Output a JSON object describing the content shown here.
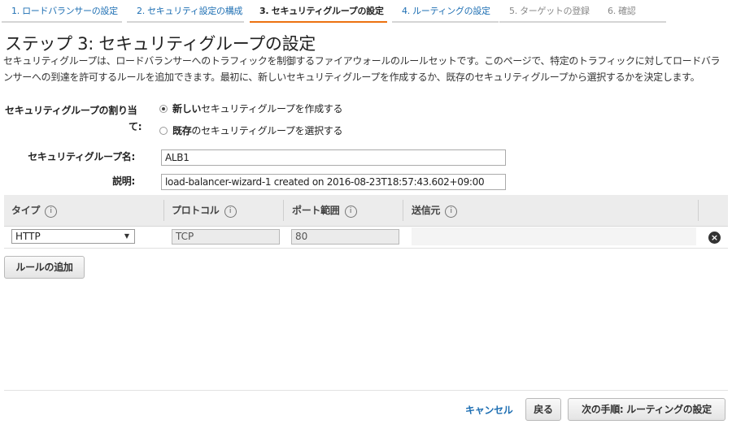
{
  "wizard": {
    "steps": [
      {
        "label": "1. ロードバランサーの設定"
      },
      {
        "label": "2. セキュリティ設定の構成"
      },
      {
        "label": "3. セキュリティグループの設定"
      },
      {
        "label": "4. ルーティングの設定"
      },
      {
        "label": "5. ターゲットの登録"
      },
      {
        "label": "6. 確認"
      }
    ],
    "active_step": 3
  },
  "page": {
    "title": "ステップ 3: セキュリティグループの設定",
    "description": "セキュリティグループは、ロードバランサーへのトラフィックを制御するファイアウォールのルールセットです。このページで、特定のトラフィックに対してロードバランサーへの到達を許可するルールを追加できます。最初に、新しいセキュリティグループを作成するか、既存のセキュリティグループから選択するかを決定します。"
  },
  "form": {
    "assign_label_line1": "セキュリティグループの割り当",
    "assign_label_line2": "て:",
    "option_new_bold": "新しい",
    "option_new_rest": "セキュリティグループを作成する",
    "option_existing_bold": "既存",
    "option_existing_rest": "のセキュリティグループを選択する",
    "selected_option": "new",
    "name_label": "セキュリティグループ名:",
    "name_value": "ALB1",
    "desc_label": "説明:",
    "desc_value": "load-balancer-wizard-1 created on 2016-08-23T18:57:43.602+09:00"
  },
  "rules_table": {
    "headers": {
      "type": "タイプ",
      "protocol": "プロトコル",
      "port_range": "ポート範囲",
      "source": "送信元"
    },
    "info_glyph": "i",
    "rows": [
      {
        "type": "HTTP",
        "protocol": "TCP",
        "port_range": "80"
      }
    ],
    "add_rule_label": "ルールの追加"
  },
  "footer": {
    "cancel_label": "キャンセル",
    "back_label": "戻る",
    "next_label": "次の手順: ルーティングの設定"
  },
  "colors": {
    "link": "#1e6fb3",
    "active_step_underline": "#ec7211",
    "table_header_bg": "#ececec"
  }
}
